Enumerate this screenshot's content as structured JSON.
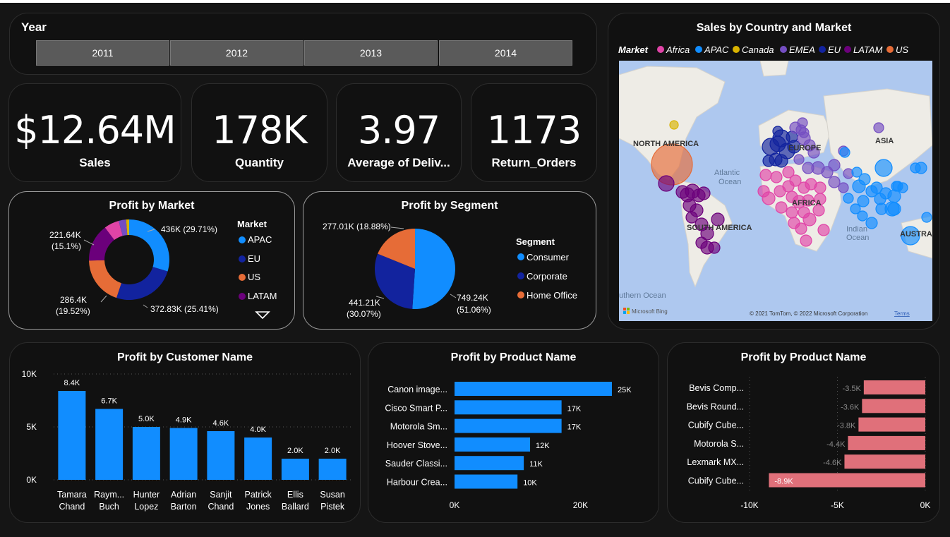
{
  "year_slicer": {
    "label": "Year",
    "options": [
      "2011",
      "2012",
      "2013",
      "2014"
    ]
  },
  "kpis": [
    {
      "value": "$12.64M",
      "label": "Sales"
    },
    {
      "value": "178K",
      "label": "Quantity"
    },
    {
      "value": "3.97",
      "label": "Average of Deliv..."
    },
    {
      "value": "1173",
      "label": "Return_Orders"
    }
  ],
  "colors": {
    "apac": "#118dff",
    "eu": "#12239e",
    "us": "#e66c37",
    "latam": "#6b007b",
    "africa": "#e044a7",
    "emea": "#744ec2",
    "canada": "#d9b300",
    "negative": "#e0707a"
  },
  "market_chart": {
    "title": "Profit by Market",
    "legend_title": "Market",
    "legend": [
      "APAC",
      "EU",
      "US",
      "LATAM"
    ],
    "labels": [
      "436K (29.71%)",
      "372.83K (25.41%)",
      "286.4K",
      "(19.52%)",
      "221.64K",
      "(15.1%)"
    ],
    "chart_data": {
      "type": "pie",
      "categories": [
        "APAC",
        "EU",
        "US",
        "LATAM",
        "Africa",
        "EMEA",
        "Canada"
      ],
      "values": [
        436000,
        372830,
        286400,
        221640,
        88870,
        43900,
        17820
      ]
    }
  },
  "segment_chart": {
    "title": "Profit by Segment",
    "legend_title": "Segment",
    "legend": [
      "Consumer",
      "Corporate",
      "Home Office"
    ],
    "labels": [
      "277.01K (18.88%)",
      "749.24K",
      "(51.06%)",
      "441.21K",
      "(30.07%)"
    ],
    "chart_data": {
      "type": "pie",
      "categories": [
        "Consumer",
        "Corporate",
        "Home Office"
      ],
      "values": [
        749240,
        441210,
        277010
      ]
    }
  },
  "map": {
    "title": "Sales by Country and Market",
    "legend_title": "Market",
    "legend": [
      "Africa",
      "APAC",
      "Canada",
      "EMEA",
      "EU",
      "LATAM",
      "US"
    ],
    "labels": [
      "NORTH AMERICA",
      "Atlantic",
      "Ocean",
      "EUROPE",
      "ASIA",
      "AFRICA",
      "SOUTH AMERICA",
      "Indian",
      "Ocean",
      "AUSTRA",
      "uthern Ocean"
    ],
    "attribution": "© 2021 TomTom, © 2022 Microsoft Corporation",
    "terms": "Terms",
    "brand": "Microsoft Bing"
  },
  "customer_chart": {
    "title": "Profit by Customer Name",
    "chart_data": {
      "type": "bar",
      "categories": [
        "Tamara Chand",
        "Raym... Buch",
        "Hunter Lopez",
        "Adrian Barton",
        "Sanjit Chand",
        "Patrick Jones",
        "Ellis Ballard",
        "Susan Pistek"
      ],
      "category_lines": [
        [
          "Tamara",
          "Chand"
        ],
        [
          "Raym...",
          "Buch"
        ],
        [
          "Hunter",
          "Lopez"
        ],
        [
          "Adrian",
          "Barton"
        ],
        [
          "Sanjit",
          "Chand"
        ],
        [
          "Patrick",
          "Jones"
        ],
        [
          "Ellis",
          "Ballard"
        ],
        [
          "Susan",
          "Pistek"
        ]
      ],
      "values": [
        8400,
        6700,
        5000,
        4900,
        4600,
        4000,
        2000,
        2000
      ],
      "data_labels": [
        "8.4K",
        "6.7K",
        "5.0K",
        "4.9K",
        "4.6K",
        "4.0K",
        "2.0K",
        "2.0K"
      ],
      "yticks": [
        "0K",
        "5K",
        "10K"
      ],
      "ytick_values": [
        0,
        5000,
        10000
      ],
      "ylim": [
        0,
        10000
      ]
    }
  },
  "product_chart": {
    "title": "Profit by Product Name",
    "chart_data": {
      "type": "bar",
      "categories": [
        "Canon image...",
        "Cisco Smart P...",
        "Motorola Sm...",
        "Hoover Stove...",
        "Sauder Classi...",
        "Harbour Crea..."
      ],
      "values": [
        25000,
        17000,
        17000,
        12000,
        11000,
        10000
      ],
      "data_labels": [
        "25K",
        "17K",
        "17K",
        "12K",
        "11K",
        "10K"
      ],
      "xticks": [
        "0K",
        "20K"
      ],
      "xtick_values": [
        0,
        20000
      ],
      "xlim": [
        0,
        25000
      ]
    }
  },
  "loss_chart": {
    "title": "Profit by Product Name",
    "chart_data": {
      "type": "bar",
      "categories": [
        "Bevis Comp...",
        "Bevis Round...",
        "Cubify Cube...",
        "Motorola S...",
        "Lexmark MX...",
        "Cubify Cube..."
      ],
      "values": [
        -3500,
        -3600,
        -3800,
        -4400,
        -4600,
        -8900
      ],
      "data_labels": [
        "-3.5K",
        "-3.6K",
        "-3.8K",
        "-4.4K",
        "-4.6K",
        "-8.9K"
      ],
      "xticks": [
        "-10K",
        "-5K",
        "0K"
      ],
      "xtick_values": [
        -10000,
        -5000,
        0
      ],
      "xlim": [
        -10000,
        0
      ]
    }
  }
}
